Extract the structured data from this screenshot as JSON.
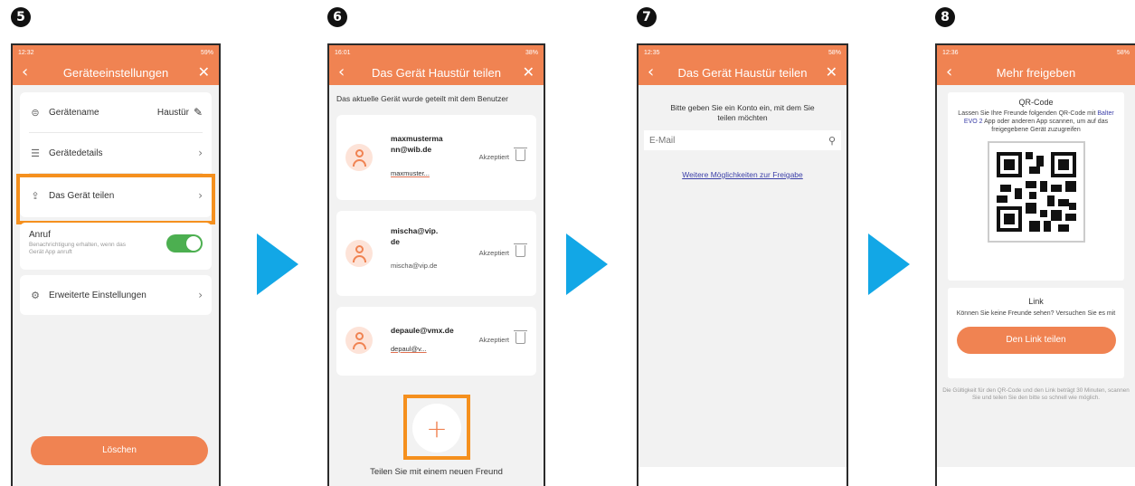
{
  "steps": [
    {
      "number": "5"
    },
    {
      "number": "6"
    },
    {
      "number": "7"
    },
    {
      "number": "8"
    }
  ],
  "screen5": {
    "status_time": "12:32",
    "status_right": "59%",
    "title": "Geräteeinstellungen",
    "rows": {
      "name_label": "Gerätename",
      "name_value": "Haustür",
      "details_label": "Gerätedetails",
      "share_label": "Das Gerät teilen",
      "call_label": "Anruf",
      "call_desc": "Benachrichtigung erhalten, wenn das Gerät App anruft",
      "advanced_label": "Erweiterte Einstellungen"
    },
    "delete_button": "Löschen"
  },
  "screen6": {
    "status_time": "16:01",
    "status_right": "38%",
    "title": "Das Gerät Haustür teilen",
    "intro": "Das aktuelle Gerät wurde geteilt mit dem Benutzer",
    "users": [
      {
        "name": "maxmusterma nn@wib.de",
        "sub": "maxmuster...",
        "status": "Akzeptiert"
      },
      {
        "name": "mischa@vip. de",
        "sub": "mischa@vip.de",
        "status": "Akzeptiert"
      },
      {
        "name": "depaule@vmx.de",
        "sub": "depaul@v...",
        "status": "Akzeptiert"
      }
    ],
    "add_label": "Teilen Sie mit einem neuen Freund",
    "add_symbol": "+"
  },
  "screen7": {
    "status_time": "12:35",
    "status_right": "58%",
    "title": "Das Gerät Haustür teilen",
    "prompt": "Bitte geben Sie ein Konto ein, mit dem Sie teilen möchten",
    "email_placeholder": "E-Mail",
    "more_link": "Weitere Möglichkeiten zur Freigabe"
  },
  "screen8": {
    "status_time": "12:36",
    "status_right": "58%",
    "title": "Mehr freigeben",
    "qr_heading": "QR-Code",
    "qr_text_before": "Lassen Sie Ihre Freunde folgenden QR-Code mit",
    "qr_app": "Balter EVO 2",
    "qr_text_after": "App oder anderen App scannen, um auf das freigegebene Gerät zuzugreifen",
    "link_heading": "Link",
    "link_text": "Können Sie keine Freunde sehen? Versuchen Sie es mit",
    "link_button": "Den Link teilen",
    "footer": "Die Gültigkeit für den QR-Code und den Link beträgt 30 Minuten, scannen Sie und teilen Sie den bitte so schnell wie möglich."
  },
  "colors": {
    "accent": "#f08352",
    "highlight": "#f5901e",
    "arrow": "#12a7e6",
    "toggle_on": "#4caf50",
    "link": "#3b3fa8"
  }
}
